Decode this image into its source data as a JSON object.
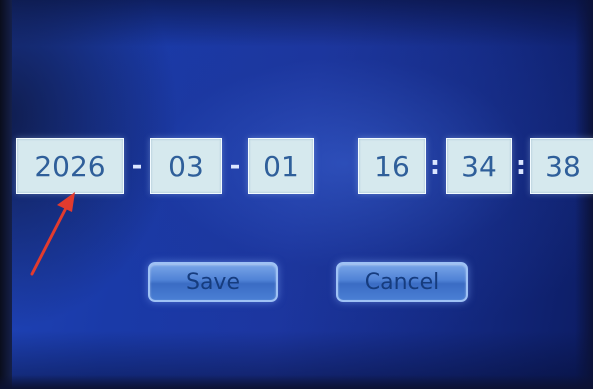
{
  "date": {
    "year": "2026",
    "month": "03",
    "day": "01",
    "separator": "-"
  },
  "time": {
    "hour": "16",
    "minute": "34",
    "second": "38",
    "separator": ":"
  },
  "buttons": {
    "save_label": "Save",
    "cancel_label": "Cancel"
  },
  "annotation": {
    "arrow_color": "#e23b2e",
    "arrow_target": "year-field"
  },
  "colors": {
    "field_bg": "#d6e9ee",
    "field_text": "#2f5f9a",
    "screen_bg": "#1a3aa8",
    "button_bg": "#4f82d6"
  }
}
